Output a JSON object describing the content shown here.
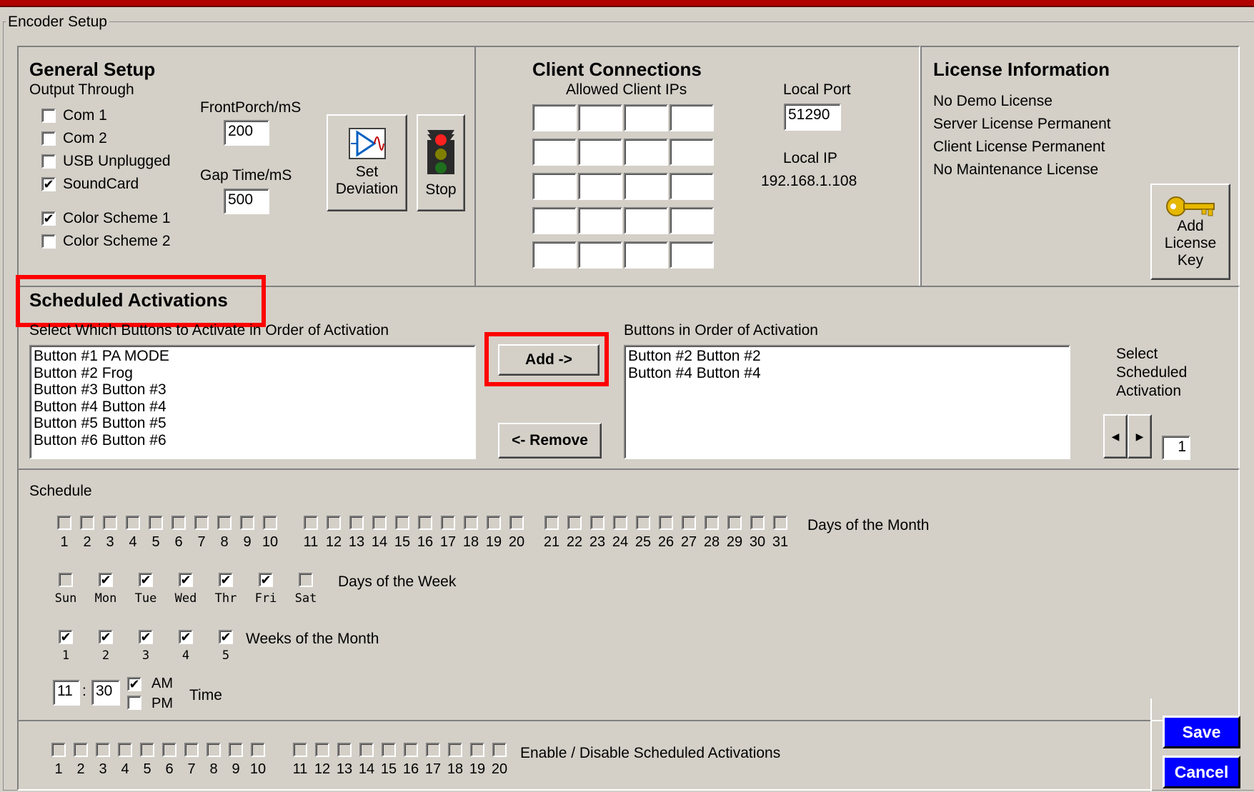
{
  "window": {
    "group_title": "Encoder Setup"
  },
  "general_setup": {
    "title": "General Setup",
    "output_label": "Output Through",
    "outputs": [
      {
        "label": "Com 1",
        "checked": false
      },
      {
        "label": "Com 2",
        "checked": false
      },
      {
        "label": "USB Unplugged",
        "checked": false
      },
      {
        "label": "SoundCard",
        "checked": true
      }
    ],
    "schemes": [
      {
        "label": "Color Scheme 1",
        "checked": true
      },
      {
        "label": "Color Scheme 2",
        "checked": false
      }
    ],
    "front_porch_label": "FrontPorch/mS",
    "front_porch_value": "200",
    "gap_time_label": "Gap Time/mS",
    "gap_time_value": "500",
    "set_deviation_label_1": "Set",
    "set_deviation_label_2": "Deviation",
    "stop_label": "Stop"
  },
  "client_connections": {
    "title": "Client Connections",
    "allowed_label": "Allowed Client IPs",
    "local_port_label": "Local Port",
    "local_port_value": "51290",
    "local_ip_label": "Local IP",
    "local_ip_value": "192.168.1.108"
  },
  "license": {
    "title": "License Information",
    "lines": [
      "No Demo License",
      "Server License Permanent",
      "Client License Permanent",
      "No Maintenance License"
    ],
    "add_key_1": "Add",
    "add_key_2": "License",
    "add_key_3": "Key"
  },
  "scheduled": {
    "title": "Scheduled Activations",
    "select_label": "Select Which Buttons to Activate in Order of Activation",
    "available": [
      "Button #1 PA MODE",
      "Button #2 Frog",
      "Button #3 Button #3",
      "Button #4 Button #4",
      "Button #5 Button #5",
      "Button #6 Button #6"
    ],
    "add_label": "Add ->",
    "remove_label": "<- Remove",
    "order_label": "Buttons in Order of Activation",
    "ordered": [
      "Button #2 Button #2",
      "Button #4 Button #4"
    ],
    "select_sched_1": "Select",
    "select_sched_2": "Scheduled",
    "select_sched_3": "Activation",
    "spin_value": "1"
  },
  "schedule": {
    "title": "Schedule",
    "days_of_month_label": "Days of the Month",
    "days_of_month": [
      "1",
      "2",
      "3",
      "4",
      "5",
      "6",
      "7",
      "8",
      "9",
      "10",
      "11",
      "12",
      "13",
      "14",
      "15",
      "16",
      "17",
      "18",
      "19",
      "20",
      "21",
      "22",
      "23",
      "24",
      "25",
      "26",
      "27",
      "28",
      "29",
      "30",
      "31"
    ],
    "days_of_week_label": "Days of the Week",
    "days_of_week": [
      {
        "label": "Sun",
        "checked": false
      },
      {
        "label": "Mon",
        "checked": true
      },
      {
        "label": "Tue",
        "checked": true
      },
      {
        "label": "Wed",
        "checked": true
      },
      {
        "label": "Thr",
        "checked": true
      },
      {
        "label": "Fri",
        "checked": true
      },
      {
        "label": "Sat",
        "checked": false
      }
    ],
    "weeks_label": "Weeks of the Month",
    "weeks": [
      "1",
      "2",
      "3",
      "4",
      "5"
    ],
    "hour": "11",
    "minute": "30",
    "am_label": "AM",
    "pm_label": "PM",
    "am_checked": true,
    "time_label": "Time"
  },
  "enable": {
    "label": "Enable / Disable Scheduled Activations",
    "numbers": [
      "1",
      "2",
      "3",
      "4",
      "5",
      "6",
      "7",
      "8",
      "9",
      "10",
      "11",
      "12",
      "13",
      "14",
      "15",
      "16",
      "17",
      "18",
      "19",
      "20"
    ]
  },
  "actions": {
    "save": "Save",
    "cancel": "Cancel"
  },
  "colors": {
    "highlight": "#ff0000",
    "action_button": "#0000ff",
    "title_bar": "#b00000"
  }
}
